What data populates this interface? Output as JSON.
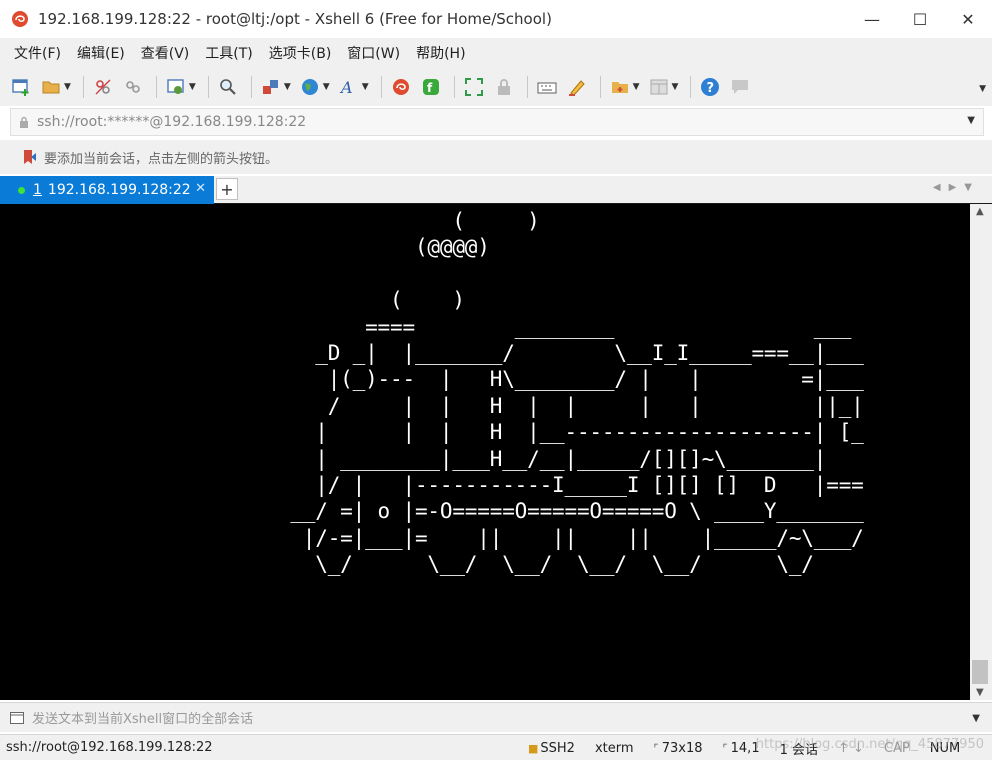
{
  "window": {
    "title": "192.168.199.128:22 - root@ltj:/opt - Xshell 6 (Free for Home/School)",
    "minimize": "—",
    "maximize": "☐",
    "close": "✕"
  },
  "menu": {
    "items": [
      "文件(F)",
      "编辑(E)",
      "查看(V)",
      "工具(T)",
      "选项卡(B)",
      "窗口(W)",
      "帮助(H)"
    ]
  },
  "toolbar": {
    "icons": [
      "new-session-icon",
      "open-folder-icon",
      "disconnect-icon",
      "reconnect-icon",
      "properties-icon",
      "find-icon",
      "transfer-icon",
      "globe-icon",
      "font-icon",
      "xshell-icon",
      "xftp-icon",
      "fullscreen-icon",
      "lock-icon",
      "keyboard-icon",
      "highlight-icon",
      "compose-icon",
      "layout-icon",
      "help-icon",
      "chat-icon"
    ]
  },
  "address": {
    "value": "ssh://root:******@192.168.199.128:22"
  },
  "hint": {
    "text": "要添加当前会话，点击左侧的箭头按钮。"
  },
  "tabs": [
    {
      "number": "1",
      "label": "192.168.199.128:22",
      "active": true,
      "status_color": "#3de23d"
    }
  ],
  "tab_add": "+",
  "terminal": {
    "lines": [
      "                  (     )",
      "               (@@@@)",
      "",
      "             (    )",
      "           ====        ________                ___",
      "       _D _|  |_______/        \\__I_I_____===__|___",
      "        |(_)---  |   H\\________/ |   |        =|___",
      "        /     |  |   H  |  |     |   |         ||_|",
      "       |      |  |   H  |__--------------------| [_",
      "       | ________|___H__/__|_____/[][]~\\_______|",
      "       |/ |   |-----------I_____I [][] []  D   |===",
      "     __/ =| o |=-O=====O=====O=====O \\ ____Y_______",
      "      |/-=|___|=    ||    ||    ||    |_____/~\\___/",
      "       \\_/      \\__/  \\__/  \\__/  \\__/      \\_/"
    ]
  },
  "compose": {
    "placeholder": "发送文本到当前Xshell窗口的全部会话"
  },
  "status": {
    "path": "ssh://root@192.168.199.128:22",
    "protocol": "SSH2",
    "terminal_type": "xterm",
    "size": "73x18",
    "cursor": "14,1",
    "sessions": "1 会话",
    "cap": "CAP",
    "num": "NUM",
    "watermark": "https://blog.csdn.net/qq_45877950"
  },
  "colors": {
    "tab_active": "#0a7bd7",
    "terminal_bg": "#000000",
    "terminal_fg": "#ffffff"
  }
}
